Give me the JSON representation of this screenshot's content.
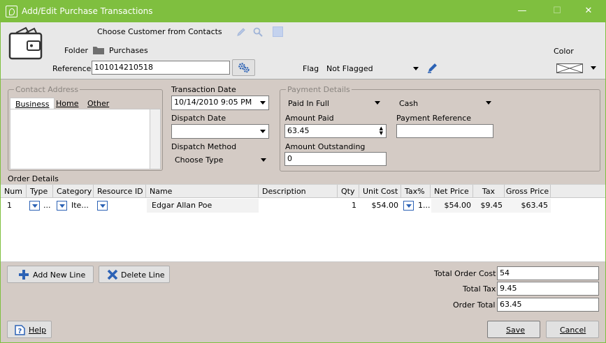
{
  "window": {
    "title": "Add/Edit Purchase Transactions",
    "minimize": "—",
    "maximize": "☐",
    "close": "✕"
  },
  "header": {
    "choose_customer": "Choose Customer from Contacts",
    "folder_label": "Folder",
    "folder_value": "Purchases",
    "reference_label": "Reference",
    "reference_value": "101014210518",
    "flag_label": "Flag",
    "flag_value": "Not Flagged",
    "color_label": "Color"
  },
  "contact_address": {
    "legend": "Contact Address",
    "tabs": [
      "Business",
      "Home",
      "Other"
    ]
  },
  "transaction": {
    "date_label": "Transaction Date",
    "date_value": "10/14/2010 9:05 PM",
    "dispatch_date_label": "Dispatch Date",
    "dispatch_date_value": "",
    "dispatch_method_label": "Dispatch Method",
    "dispatch_method_value": "Choose Type"
  },
  "payment": {
    "legend": "Payment Details",
    "status_value": "Paid In Full",
    "method_value": "Cash",
    "amount_paid_label": "Amount Paid",
    "amount_paid_value": "63.45",
    "payment_reference_label": "Payment Reference",
    "payment_reference_value": "",
    "amount_outstanding_label": "Amount Outstanding",
    "amount_outstanding_value": "0"
  },
  "order": {
    "label": "Order Details",
    "columns": [
      "Num",
      "Type",
      "Category",
      "Resource ID",
      "Name",
      "Description",
      "Qty",
      "Unit Cost",
      "Tax%",
      "Net Price",
      "Tax",
      "Gross Price"
    ],
    "rows": [
      {
        "num": "1",
        "type": "...",
        "category": "Ite...",
        "resource_id": "",
        "name": "Edgar Allan Poe",
        "description": "",
        "qty": "1",
        "unit_cost": "$54.00",
        "tax_pct": "1...",
        "net_price": "$54.00",
        "tax": "$9.45",
        "gross_price": "$63.45"
      }
    ]
  },
  "actions": {
    "add_line": "Add New Line",
    "delete_line": "Delete Line",
    "help": "Help",
    "save": "Save",
    "cancel": "Cancel"
  },
  "totals": {
    "order_cost_label": "Total Order Cost",
    "order_cost_value": "54",
    "tax_label": "Total Tax",
    "tax_value": "9.45",
    "order_total_label": "Order Total",
    "order_total_value": "63.45"
  },
  "colors": {
    "titlebar": "#7fbf3f",
    "accent_blue": "#2c62b5",
    "panel": "#d4cbc5"
  }
}
